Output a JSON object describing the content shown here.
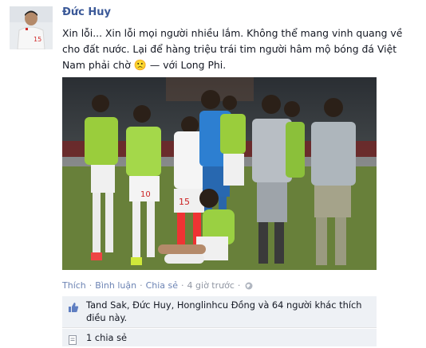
{
  "post": {
    "author": "Đức Huy",
    "text_main": "Xin lỗi... Xin lỗi mọi người nhiều lắm. Không thể mang vinh quang về cho đất nước. Lại để hàng triệu trái tim người hâm mộ bóng đá Việt Nam phải chờ",
    "emoticon": "🙁",
    "with_text": " — với Long Phi.",
    "actions": {
      "like": "Thích",
      "comment": "Bình luận",
      "share": "Chia sẻ",
      "time": "4 giờ trước",
      "separator": "·"
    },
    "likes_text": "Tand Sak, Đức Huy, Honglinhcu Đồng và 64 người khác thích điều này.",
    "shares_text": "1 chia sẻ"
  },
  "colors": {
    "link_blue": "#3b5998",
    "muted": "#9197a3",
    "feedback_bg": "#eef1f5"
  },
  "icons": {
    "like": "thumbs-up-icon",
    "share": "share-icon",
    "privacy": "globe-icon"
  }
}
